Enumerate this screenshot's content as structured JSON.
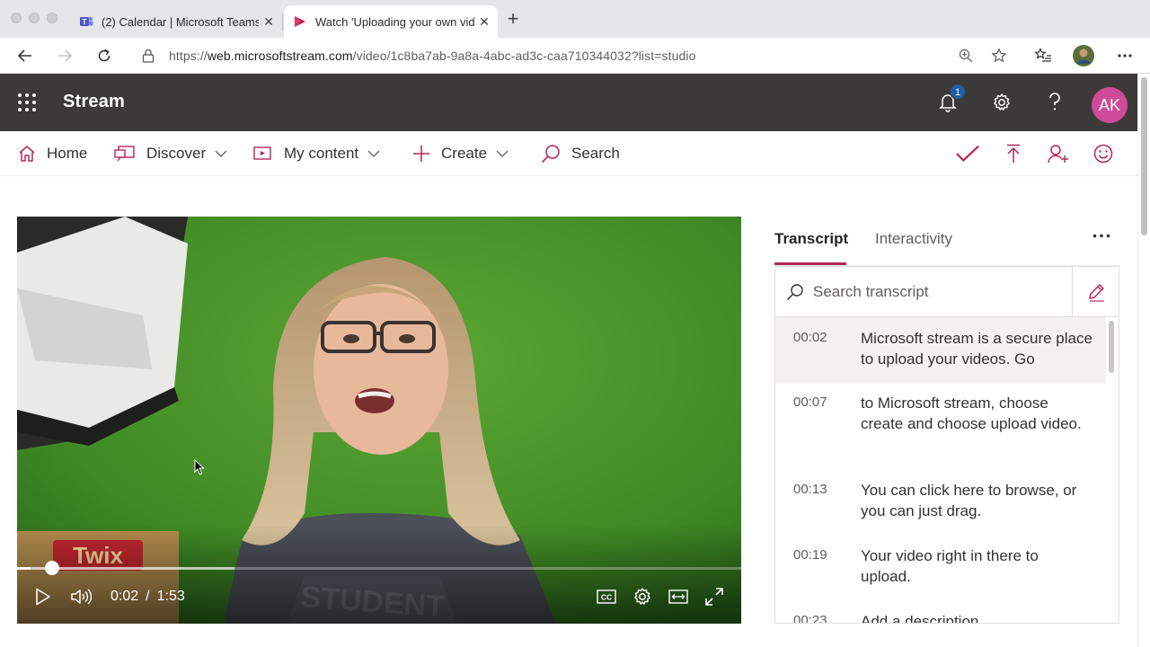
{
  "browser": {
    "tabs": [
      {
        "title": "(2) Calendar | Microsoft Teams",
        "icon": "teams-icon",
        "active": false
      },
      {
        "title": "Watch 'Uploading your own videos'",
        "icon": "stream-icon",
        "active": true
      }
    ],
    "url_host": "web.microsoftstream.com",
    "url_scheme": "https://",
    "url_path": "/video/1c8ba7ab-9a8a-4abc-ad3c-caa710344032?list=studio"
  },
  "suite": {
    "app_name": "Stream",
    "notification_count": "1",
    "avatar_initials": "AK",
    "colors": {
      "header_bg": "#3b3a39",
      "avatar_bg": "#d04a9a",
      "accent": "#b4265a"
    }
  },
  "nav": {
    "home": "Home",
    "discover": "Discover",
    "my_content": "My content",
    "create": "Create",
    "search": "Search"
  },
  "player": {
    "current_time": "0:02",
    "separator": "/",
    "duration": "1:53",
    "progress_fraction": 0.018,
    "buffered_fraction": 0.3
  },
  "panel": {
    "tab_transcript": "Transcript",
    "tab_interactivity": "Interactivity",
    "search_placeholder": "Search transcript",
    "entries": [
      {
        "time": "00:02",
        "text": "Microsoft stream is a secure place to upload your videos. Go",
        "active": true
      },
      {
        "time": "00:07",
        "text": "to Microsoft stream, choose create and choose upload video.",
        "active": false
      },
      {
        "time": "00:13",
        "text": "You can click here to browse, or you can just drag.",
        "active": false
      },
      {
        "time": "00:19",
        "text": "Your video right in there to upload.",
        "active": false
      },
      {
        "time": "00:23",
        "text": "Add a description",
        "active": false
      }
    ]
  }
}
